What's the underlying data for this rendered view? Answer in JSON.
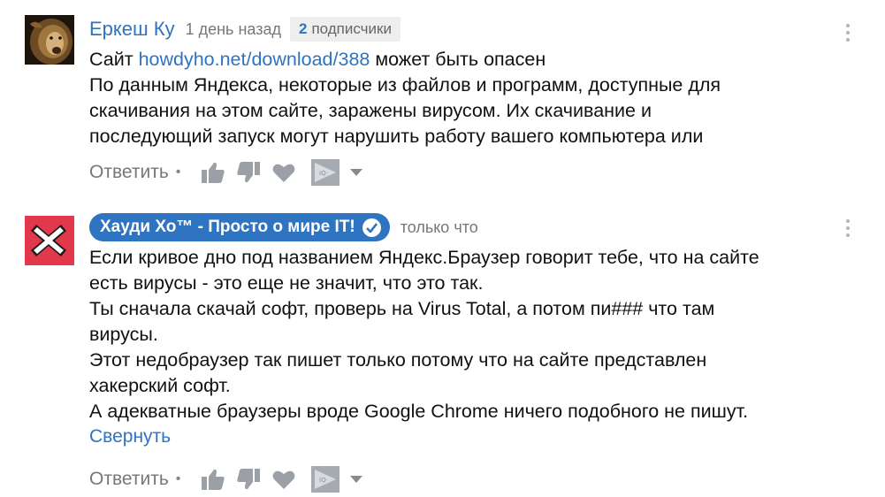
{
  "comments": [
    {
      "author": "Еркеш Ку",
      "time": "1 день назад",
      "subscribers": {
        "count": "2",
        "label": "подписчики"
      },
      "lines": [
        [
          "Сайт ",
          "howdyho.net/download/388",
          " может быть опасен"
        ],
        "По данным Яндекса, некоторые из файлов и программ, доступные для",
        "скачивания на этом сайте, заражены вирусом. Их скачивание и",
        "последующий запуск могут нарушить работу вашего компьютера или"
      ],
      "actions": {
        "reply": "Ответить",
        "separator": "•"
      }
    },
    {
      "author": "Хауди Хо™ - Просто о мире IT!",
      "time": "только что",
      "lines": [
        "Если кривое дно под названием Яндекс.Браузер говорит тебе, что на сайте",
        "есть вирусы - это еще не значит, что это так.",
        "Ты сначала скачай софт, проверь на Virus Total, а потом пи### что там",
        "вирусы.",
        "Этот недобраузер так пишет только потому что на сайте представлен",
        "хакерский софт.",
        "А адекватные браузеры вроде Google Chrome ничего подобного не пишут."
      ],
      "collapse_label": "Свернуть",
      "actions": {
        "reply": "Ответить",
        "separator": "•"
      }
    }
  ],
  "icons": {
    "avatar1": "lion-avatar",
    "avatar2": "red-x-avatar",
    "verified": "check-icon",
    "like": "thumb-up-icon",
    "dislike": "thumb-down-icon",
    "heart": "heart-icon",
    "promo": "promo-icon",
    "dropdown": "chevron-down-icon",
    "menu": "kebab-menu-icon"
  },
  "colors": {
    "link": "#2f74c0",
    "muted": "#777777",
    "icon": "#9aa0a6"
  }
}
